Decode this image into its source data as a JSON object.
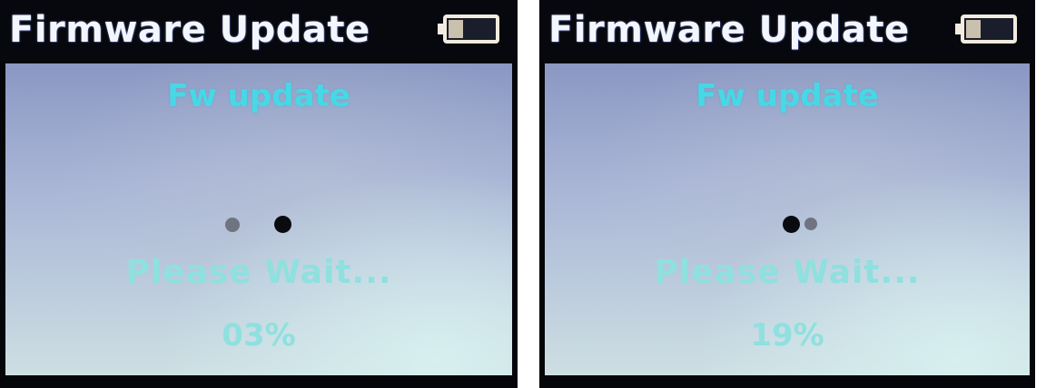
{
  "panels": [
    {
      "title": "Firmware Update",
      "heading": "Fw update",
      "status": "Please Wait...",
      "progress_text": "03%",
      "progress_percent": 3,
      "battery_icon": "battery-low-icon",
      "spinner_icon": "loading-dots-icon"
    },
    {
      "title": "Firmware Update",
      "heading": "Fw update",
      "status": "Please Wait...",
      "progress_text": "19%",
      "progress_percent": 19,
      "battery_icon": "battery-low-icon",
      "spinner_icon": "loading-dots-icon"
    }
  ],
  "colors": {
    "title_bar": "#07080d",
    "title_text": "#f3f6ff",
    "heading_text": "#47d8e6",
    "status_text": "#8fe0df",
    "screen_top": "#8a97c2",
    "screen_bottom": "#cddfe2"
  }
}
